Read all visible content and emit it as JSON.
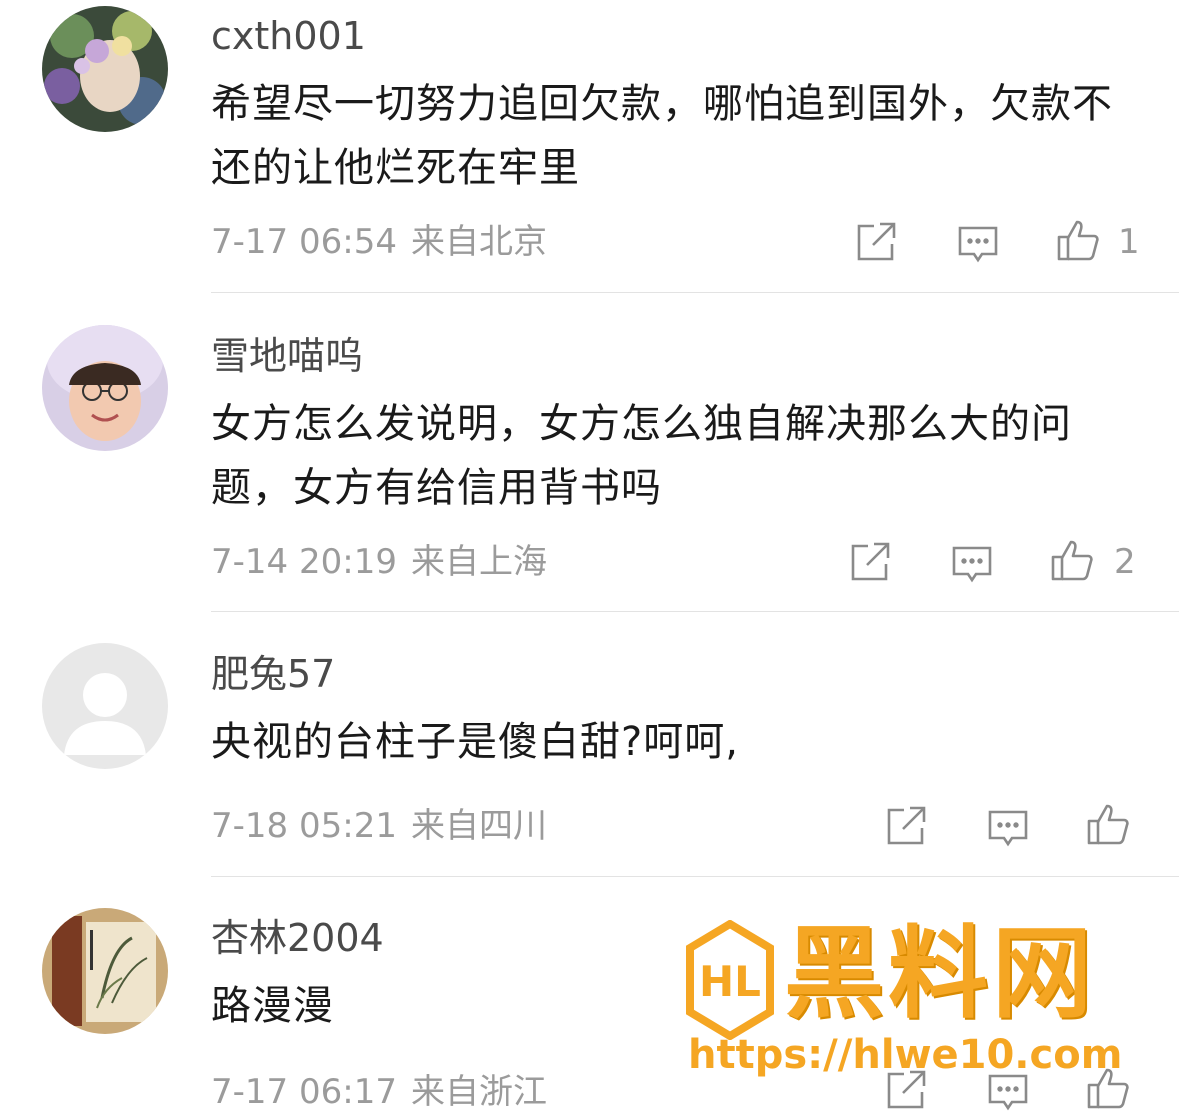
{
  "comments": [
    {
      "username": "cxth001",
      "text": "希望尽一切努力追回欠款，哪怕追到国外，欠款不还的让他烂死在牢里",
      "date": "7-17 06:54",
      "location": "来自北京",
      "likes": "1"
    },
    {
      "username": "雪地喵呜",
      "text": "女方怎么发说明，女方怎么独自解决那么大的问题，女方有给信用背书吗",
      "date": "7-14 20:19",
      "location": "来自上海",
      "likes": "2"
    },
    {
      "username": "肥兔57",
      "text": "央视的台柱子是傻白甜?呵呵,",
      "date": "7-18 05:21",
      "location": "来自四川",
      "likes": ""
    },
    {
      "username": "杏林2004",
      "text": "路漫漫",
      "date": "7-17 06:17",
      "location": "来自浙江",
      "likes": ""
    }
  ],
  "icons": {
    "share": "share-icon",
    "reply": "comment-icon",
    "like": "thumbs-up-icon"
  },
  "colors": {
    "text": "#1a1a1a",
    "meta": "#9b9b9b",
    "divider": "#e3e3e3",
    "watermark": "#f5a623"
  },
  "watermark": {
    "logo_text": "HL",
    "title": "黑料网",
    "url": "https://hlwe10.com"
  }
}
